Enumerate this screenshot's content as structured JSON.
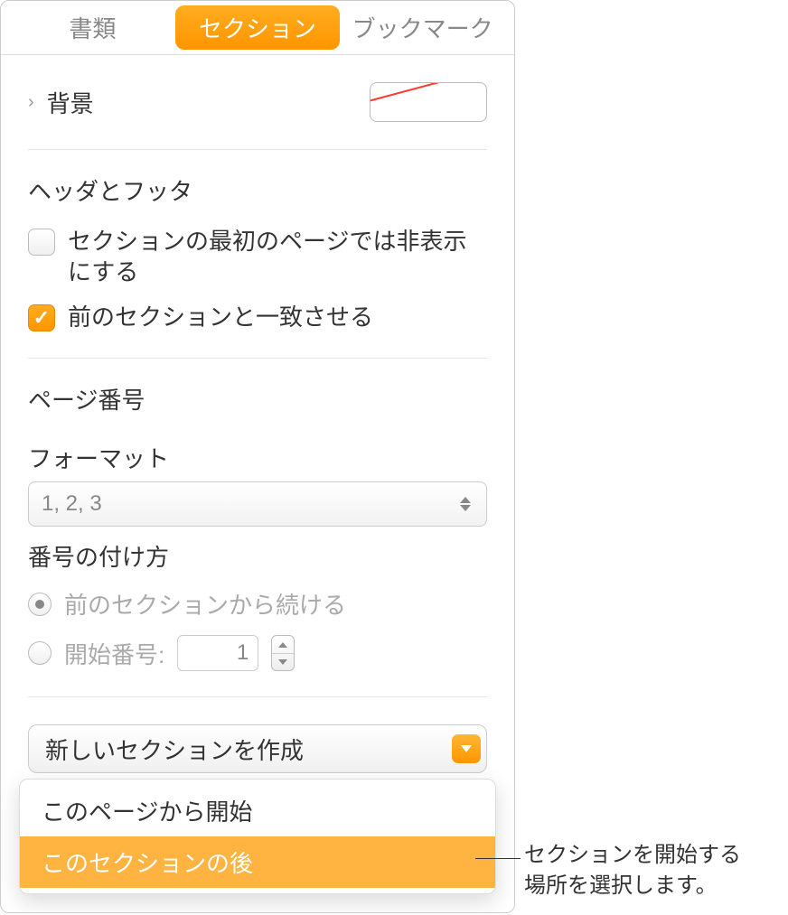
{
  "tabs": {
    "document": "書類",
    "section": "セクション",
    "bookmark": "ブックマーク"
  },
  "background": {
    "label": "背景"
  },
  "headers_footers": {
    "heading": "ヘッダとフッタ",
    "hide_first_page": "セクションの最初のページでは非表示にする",
    "match_previous": "前のセクションと一致させる"
  },
  "page_number": {
    "heading": "ページ番号",
    "format_label": "フォーマット",
    "format_value": "1, 2, 3",
    "numbering_label": "番号の付け方",
    "continue": "前のセクションから続ける",
    "start_at_label": "開始番号:",
    "start_at_value": "1"
  },
  "new_section": {
    "button": "新しいセクションを作成",
    "option_start_page": "このページから開始",
    "option_after_section": "このセクションの後"
  },
  "callout": {
    "line1": "セクションを開始する",
    "line2": "場所を選択します。"
  }
}
